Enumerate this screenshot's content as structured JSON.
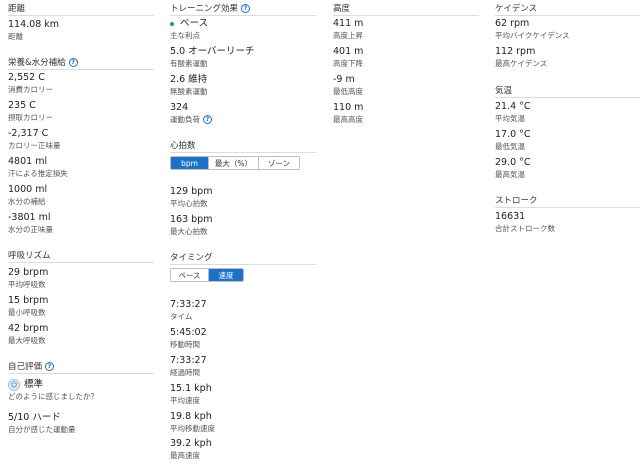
{
  "distance": {
    "label": "距離",
    "value": "114.08 km",
    "sublabel": "距離"
  },
  "nutrition": {
    "title": "栄養&水分補給",
    "stats": [
      {
        "value": "2,552 C",
        "label": "消費カロリー"
      },
      {
        "value": "235 C",
        "label": "摂取カロリー"
      },
      {
        "value": "-2,317 C",
        "label": "カロリー正味量"
      },
      {
        "value": "4801 ml",
        "label": "汗による推定損失"
      },
      {
        "value": "1000 ml",
        "label": "水分の補給"
      },
      {
        "value": "-3801 ml",
        "label": "水分の正味量"
      }
    ]
  },
  "respiration": {
    "title": "呼吸リズム",
    "stats": [
      {
        "value": "29 brpm",
        "label": "平均呼吸数"
      },
      {
        "value": "15 brpm",
        "label": "最小呼吸数"
      },
      {
        "value": "42 brpm",
        "label": "最大呼吸数"
      }
    ]
  },
  "self_eval": {
    "title": "自己評価",
    "feeling_value": "標準",
    "feeling_label": "どのように感じましたか？",
    "effort_value": "5/10 ハード",
    "effort_label": "自分が感じた運動量"
  },
  "training_effect": {
    "title": "トレーニング効果",
    "stats": [
      {
        "value": "ベース",
        "label": "主な利点"
      },
      {
        "value": "5.0 オーバーリーチ",
        "label": "有酸素運動"
      },
      {
        "value": "2.6 維持",
        "label": "無酸素運動"
      },
      {
        "value": "324",
        "label": "運動負荷"
      }
    ]
  },
  "heart_rate": {
    "title": "心拍数",
    "tabs": [
      "bpm",
      "最大（%）",
      "ゾーン"
    ],
    "stats": [
      {
        "value": "129 bpm",
        "label": "平均心拍数"
      },
      {
        "value": "163 bpm",
        "label": "最大心拍数"
      }
    ]
  },
  "timing": {
    "title": "タイミング",
    "tabs": [
      "ペース",
      "速度"
    ],
    "stats": [
      {
        "value": "7:33:27",
        "label": "タイム"
      },
      {
        "value": "5:45:02",
        "label": "移動時間"
      },
      {
        "value": "7:33:27",
        "label": "経過時間"
      },
      {
        "value": "15.1 kph",
        "label": "平均速度"
      },
      {
        "value": "19.8 kph",
        "label": "平均移動速度"
      },
      {
        "value": "39.2 kph",
        "label": "最高速度"
      }
    ]
  },
  "elevation": {
    "title": "高度",
    "stats": [
      {
        "value": "411 m",
        "label": "高度上昇"
      },
      {
        "value": "401 m",
        "label": "高度下降"
      },
      {
        "value": "-9 m",
        "label": "最低高度"
      },
      {
        "value": "110 m",
        "label": "最高高度"
      }
    ]
  },
  "cadence": {
    "title": "ケイデンス",
    "stats": [
      {
        "value": "62 rpm",
        "label": "平均バイクケイデンス"
      },
      {
        "value": "112 rpm",
        "label": "最高ケイデンス"
      }
    ]
  },
  "temperature": {
    "title": "気温",
    "stats": [
      {
        "value": "21.4 °C",
        "label": "平均気温"
      },
      {
        "value": "17.0 °C",
        "label": "最低気温"
      },
      {
        "value": "29.0 °C",
        "label": "最高気温"
      }
    ]
  },
  "strokes": {
    "title": "ストローク",
    "stats": [
      {
        "value": "16631",
        "label": "合計ストローク数"
      }
    ]
  },
  "colors": {
    "accent": "#1a73c7",
    "green_dot": "#1aa260",
    "divider": "#dcdcdc"
  },
  "icons": {
    "info": "info-icon",
    "face": "face-icon",
    "dot": "status-dot-icon"
  }
}
